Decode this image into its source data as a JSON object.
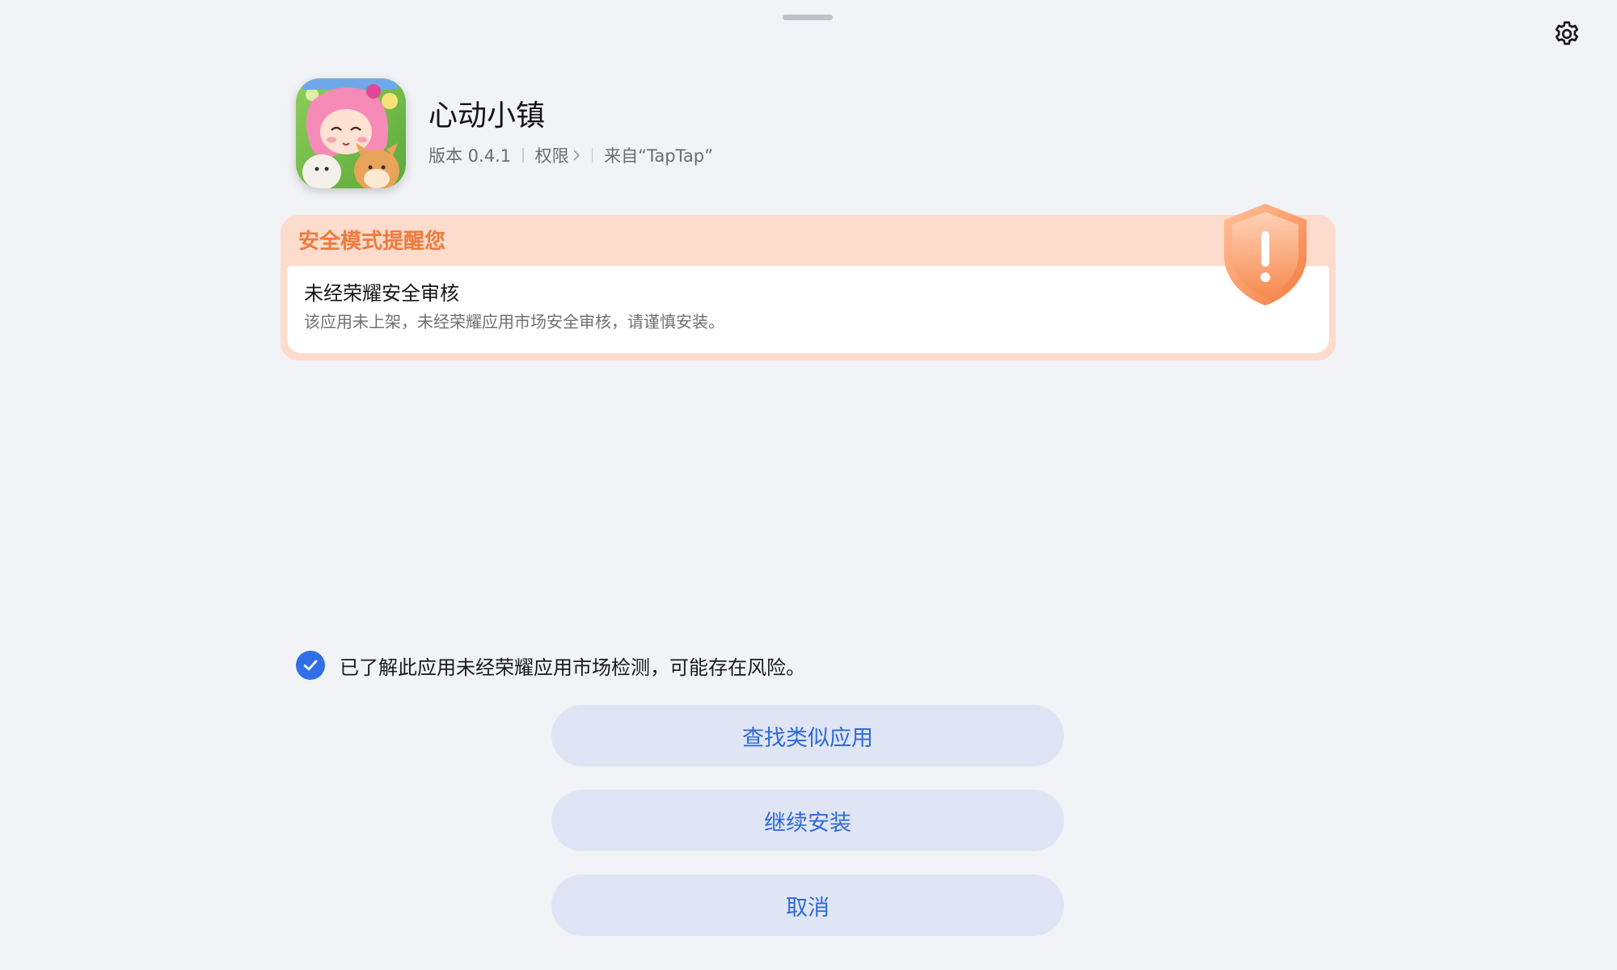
{
  "app": {
    "name": "心动小镇",
    "version": "版本 0.4.1",
    "permissions": "权限",
    "source": "来自“TapTap”",
    "icon_name": "app-icon-girl-with-pets"
  },
  "warning": {
    "title": "安全模式提醒您",
    "heading": "未经荣耀安全审核",
    "description": "该应用未上架，未经荣耀应用市场安全审核，请谨慎安装。",
    "icon_name": "warning-shield-icon",
    "accent_color": "#ee7a3b"
  },
  "acknowledge": {
    "text": "已了解此应用未经荣耀应用市场检测，可能存在风险。",
    "checked": true,
    "accent_color": "#2f6fe8"
  },
  "buttons": {
    "find_similar": "查找类似应用",
    "continue_install": "继续安装",
    "cancel": "取消"
  },
  "icons": {
    "settings": "gear-icon",
    "handle": "drag-handle"
  }
}
